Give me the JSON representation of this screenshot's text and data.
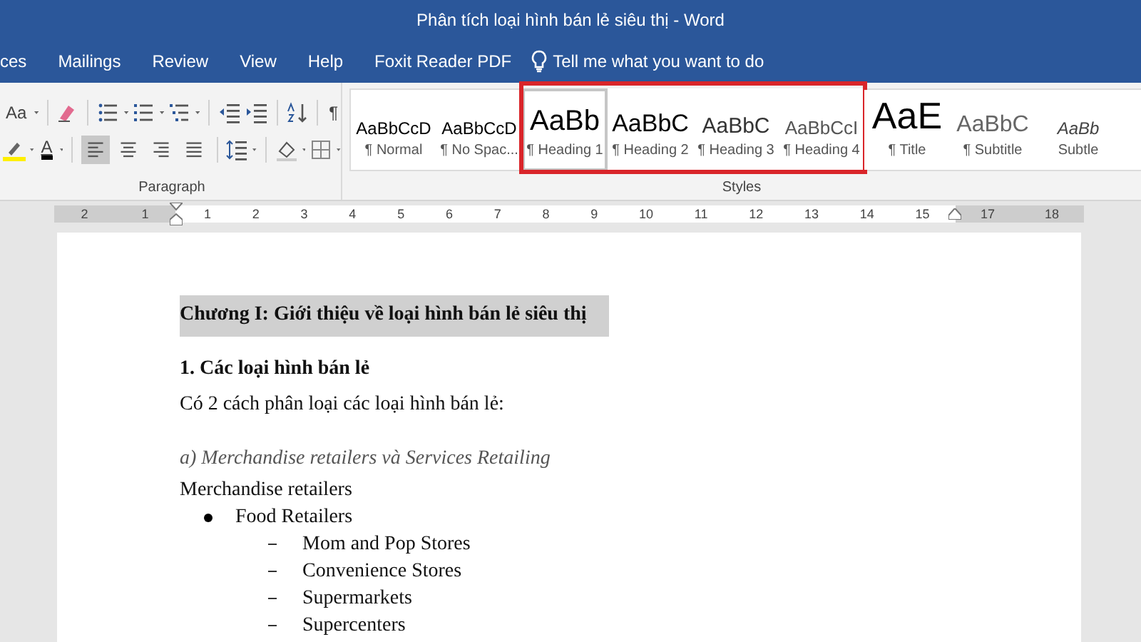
{
  "window": {
    "title": "Phân tích loại hình bán lẻ siêu thị  -  Word"
  },
  "tabs": [
    {
      "label": "ces",
      "selected": false
    },
    {
      "label": "Mailings",
      "selected": false
    },
    {
      "label": "Review",
      "selected": false
    },
    {
      "label": "View",
      "selected": false
    },
    {
      "label": "Help",
      "selected": false
    },
    {
      "label": "Foxit Reader PDF",
      "selected": false
    }
  ],
  "tell_me": {
    "placeholder": "Tell me what you want to do"
  },
  "paragraph_group": {
    "label": "Paragraph",
    "font_case": "Aa",
    "pilcrow": "¶",
    "font_color": "A",
    "alignments": [
      {
        "kind": "left",
        "selected": true
      },
      {
        "kind": "center",
        "selected": false
      },
      {
        "kind": "right",
        "selected": false
      },
      {
        "kind": "justify",
        "selected": false
      }
    ]
  },
  "styles_group": {
    "label": "Styles",
    "items": [
      {
        "preview": "AaBbCcD",
        "label": "¶ Normal",
        "kind": "normal",
        "selected": false,
        "highlighted": false
      },
      {
        "preview": "AaBbCcD",
        "label": "¶ No Spac...",
        "kind": "normal",
        "selected": false,
        "highlighted": false
      },
      {
        "preview": "AaBb",
        "label": "¶ Heading 1",
        "kind": "h1",
        "selected": true,
        "highlighted": true
      },
      {
        "preview": "AaBbC",
        "label": "¶ Heading 2",
        "kind": "h2",
        "selected": false,
        "highlighted": true
      },
      {
        "preview": "AaBbC",
        "label": "¶ Heading 3",
        "kind": "h3",
        "selected": false,
        "highlighted": true
      },
      {
        "preview": "AaBbCcI",
        "label": "¶ Heading 4",
        "kind": "h4",
        "selected": false,
        "highlighted": true
      },
      {
        "preview": "AaE",
        "label": "¶ Title",
        "kind": "title",
        "selected": false,
        "highlighted": false
      },
      {
        "preview": "AaBbC",
        "label": "¶ Subtitle",
        "kind": "subtitle",
        "selected": false,
        "highlighted": false
      },
      {
        "preview": "AaBb",
        "label": "Subtle",
        "kind": "subtle",
        "selected": false,
        "highlighted": false
      }
    ]
  },
  "ruler": {
    "left_marks": [
      "2",
      "1"
    ],
    "marks": [
      "1",
      "2",
      "3",
      "4",
      "5",
      "6",
      "7",
      "8",
      "9",
      "10",
      "11",
      "12",
      "13",
      "14",
      "15"
    ],
    "right_marks": [
      "17",
      "18"
    ]
  },
  "document": {
    "paragraphs": [
      {
        "kind": "chapter",
        "text": "Chương I: Giới thiệu về loại hình bán lẻ siêu thị"
      },
      {
        "kind": "heading",
        "text": "1. Các loại hình bán lẻ"
      },
      {
        "kind": "body",
        "text": "Có 2 cách phân loại các loại hình bán lẻ:"
      },
      {
        "kind": "subheading",
        "text": "a) Merchandise retailers và Services Retailing"
      },
      {
        "kind": "body",
        "text": "Merchandise retailers"
      },
      {
        "kind": "bullet",
        "text": "Food Retailers"
      },
      {
        "kind": "dash",
        "text": "Mom and Pop Stores"
      },
      {
        "kind": "dash",
        "text": "Convenience Stores"
      },
      {
        "kind": "dash",
        "text": "Supermarkets"
      },
      {
        "kind": "dash",
        "text": "Supercenters"
      }
    ]
  }
}
